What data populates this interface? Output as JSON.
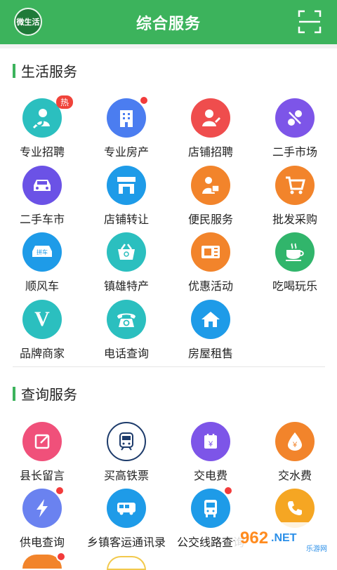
{
  "header": {
    "title": "综合服务",
    "logo_text": "微生活"
  },
  "sections": {
    "life": {
      "title": "生活服务",
      "items": [
        {
          "label": "专业招聘",
          "badge": "热"
        },
        {
          "label": "专业房产"
        },
        {
          "label": "店铺招聘"
        },
        {
          "label": "二手市场"
        },
        {
          "label": "二手车市"
        },
        {
          "label": "店铺转让"
        },
        {
          "label": "便民服务"
        },
        {
          "label": "批发采购"
        },
        {
          "label": "顺风车",
          "icon_text": "拼车"
        },
        {
          "label": "镇雄特产"
        },
        {
          "label": "优惠活动"
        },
        {
          "label": "吃喝玩乐"
        },
        {
          "label": "品牌商家",
          "icon_text": "V"
        },
        {
          "label": "电话查询"
        },
        {
          "label": "房屋租售"
        }
      ]
    },
    "query": {
      "title": "查询服务",
      "items": [
        {
          "label": "县长留言"
        },
        {
          "label": "买高铁票"
        },
        {
          "label": "交电费",
          "icon_text": "¥"
        },
        {
          "label": "交水费",
          "icon_text": "¥"
        },
        {
          "label": "供电查询"
        },
        {
          "label": "乡镇客运通讯录"
        },
        {
          "label": "公交线路查询"
        },
        {
          "label": ""
        }
      ]
    }
  },
  "watermark": {
    "brand": "962",
    "net": ".NET",
    "sub": "乐游网"
  },
  "colors": {
    "accent": "#3cb35c"
  }
}
